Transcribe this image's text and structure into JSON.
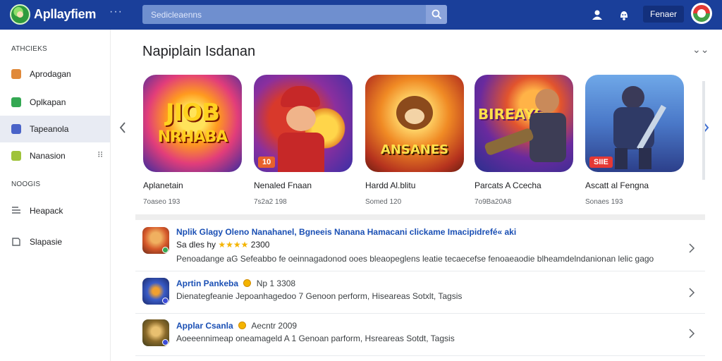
{
  "header": {
    "brand": "Apllayfiem",
    "search_placeholder": "Sedicleaenns",
    "signin_label": "Fenaer",
    "icons": [
      "logo",
      "more-dots-icon",
      "search-icon",
      "person-icon",
      "notification-icon",
      "avatar"
    ]
  },
  "sidebar": {
    "heading_top": "ATHCIEKS",
    "items": [
      {
        "label": "Aprodagan",
        "icon": "apps-icon",
        "color": "#e0893a"
      },
      {
        "label": "Oplkapan",
        "icon": "games-icon",
        "color": "#34a853"
      },
      {
        "label": "Tapeanola",
        "icon": "movies-icon",
        "color": "#4a63c8",
        "active": true
      },
      {
        "label": "Nanasion",
        "icon": "books-icon",
        "color": "#9fc33a",
        "more": "⁝⁝"
      }
    ],
    "heading_bottom": "NOOGIS",
    "links": [
      {
        "label": "Heapack",
        "icon": "library-icon"
      },
      {
        "label": "Slapasie",
        "icon": "wishlist-icon"
      }
    ]
  },
  "main": {
    "section_title": "Napiplain Isdanan",
    "section_more": "⌄⌄",
    "cards": [
      {
        "title": "Aplanetain",
        "meta": "7oaseo 193",
        "art": "JIOB NRHABA",
        "badge": ""
      },
      {
        "title": "Nenaled Fnaan",
        "meta": "7s2a2 198",
        "art": "",
        "badge": "10"
      },
      {
        "title": "Hardd Al.blitu",
        "meta": "Somed 120",
        "art": "ANSANES",
        "badge": ""
      },
      {
        "title": "Parcats A Ccecha",
        "meta": "7o9Ba20A8",
        "art": "BIREAYS",
        "badge": ""
      },
      {
        "title": "Ascatt al Fengna",
        "meta": "Sonaes 193",
        "art": "",
        "badge": "SIIE"
      }
    ],
    "list": [
      {
        "title": "Nplik Glagy Oleno Nanahanel, Bgneeis Nanana Hamacani clickame Imacipidrefé« aki",
        "sub_prefix": "Sa dles hy",
        "rating": "★★★★",
        "sub_suffix": "2300",
        "desc": "Penoadange  aG Sefeabbo  fe oeinnagadonod ooes bleaopeglens  leatie tecaecefse  fenoaeaodie  blheamdelndanionan  lelic gago",
        "icon_dot": "#34a853"
      },
      {
        "title": "Aprtin Pankeba",
        "sub_prefix": "",
        "rating": "",
        "sub_suffix": "Np 1 3308",
        "desc": "Dienategfeanie  Jepoanhagedoo 7 Genoon perform,  Hiseareas Sotxlt,  Tagsis",
        "icon_dot": "#3b4bd8"
      },
      {
        "title": "Applar Csanla",
        "sub_prefix": "",
        "rating": "",
        "sub_suffix": "Aecntr  2009",
        "desc": "Aoeeennimeap oneamageld A 1 Genoan parform,  Hsreareas Sotdt,  Tagsis",
        "icon_dot": "#3b4bd8"
      }
    ]
  },
  "colors": {
    "topbar": "#1a3f9a",
    "link": "#1a4fb4",
    "star": "#f4b400"
  }
}
